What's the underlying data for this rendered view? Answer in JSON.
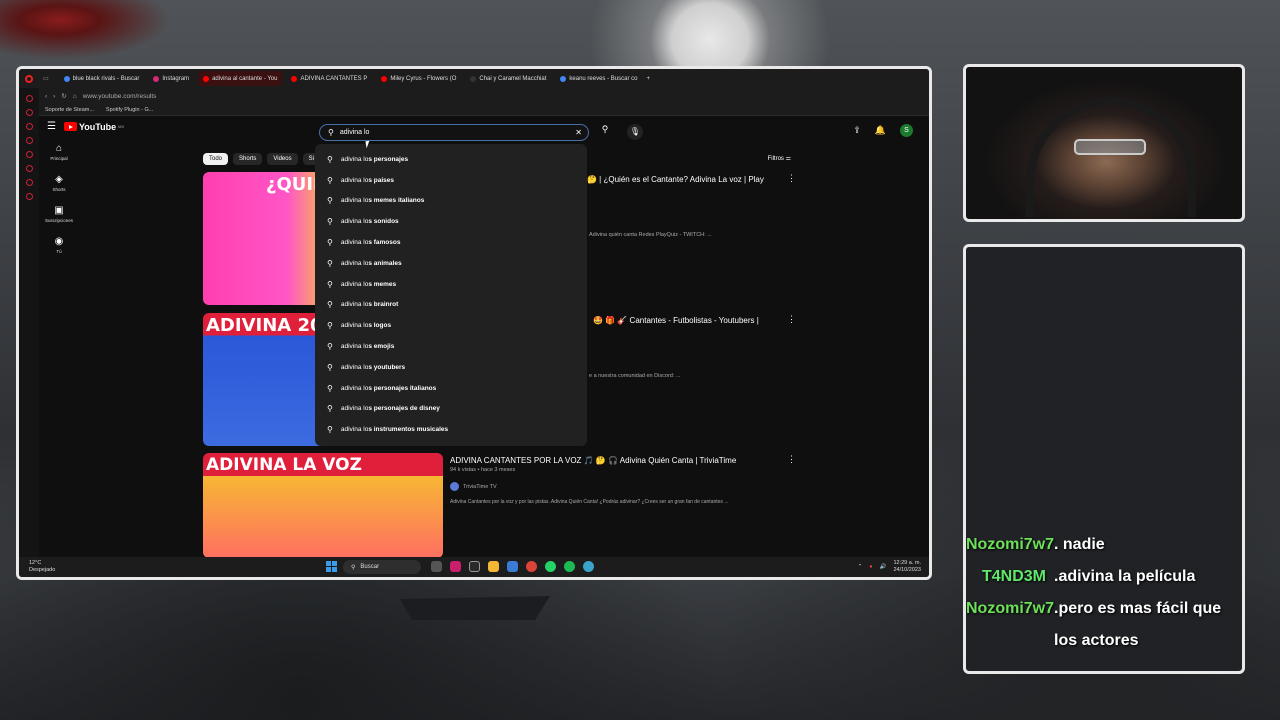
{
  "browser": {
    "tabs": [
      {
        "label": "blue black rivals - Buscar",
        "color": "#4285f4",
        "active": false
      },
      {
        "label": "Instagram",
        "color": "#d62976",
        "active": false
      },
      {
        "label": "adivina al cantante - You",
        "color": "#ff0000",
        "active": true
      },
      {
        "label": "ADIVINA CANTANTES P",
        "color": "#ff0000",
        "active": false
      },
      {
        "label": "Miley Cyrus - Flowers (O",
        "color": "#ff0000",
        "active": false
      },
      {
        "label": "Chai y Caramel Macchiat",
        "color": "#333333",
        "active": false
      },
      {
        "label": "keanu reeves - Buscar co",
        "color": "#4285f4",
        "active": false
      }
    ],
    "url": "www.youtube.com/results",
    "bookmarks": [
      "Soporte de Steam...",
      "Spotify Plugin - G..."
    ]
  },
  "youtube": {
    "logo_text": "YouTube",
    "logo_region": "MX",
    "nav": [
      {
        "icon": "home-icon",
        "glyph": "⌂",
        "label": "Principal"
      },
      {
        "icon": "shorts-icon",
        "glyph": "◈",
        "label": "Shorts"
      },
      {
        "icon": "subscriptions-icon",
        "glyph": "▣",
        "label": "Suscripciones"
      },
      {
        "icon": "you-icon",
        "glyph": "◉",
        "label": "Tú"
      }
    ],
    "search": {
      "value": "adivina lo",
      "clear_glyph": "✕",
      "search_glyph": "⚲",
      "mic_glyph": "🎙"
    },
    "avatar_letter": "S",
    "filters": {
      "label": "Filtros"
    },
    "chips": [
      "Todo",
      "Shorts",
      "Videos",
      "Si"
    ],
    "suggestions": [
      {
        "prefix": "adivina lo",
        "rest": "s personajes"
      },
      {
        "prefix": "adivina lo",
        "rest": "s países"
      },
      {
        "prefix": "adivina lo",
        "rest": "s memes italianos"
      },
      {
        "prefix": "adivina lo",
        "rest": "s sonidos"
      },
      {
        "prefix": "adivina lo",
        "rest": "s famosos"
      },
      {
        "prefix": "adivina lo",
        "rest": "s animales"
      },
      {
        "prefix": "adivina lo",
        "rest": "s memes"
      },
      {
        "prefix": "adivina lo",
        "rest": "s brainrot"
      },
      {
        "prefix": "adivina lo",
        "rest": "s logos"
      },
      {
        "prefix": "adivina lo",
        "rest": "s emojis"
      },
      {
        "prefix": "adivina lo",
        "rest": "s youtubers"
      },
      {
        "prefix": "adivina lo",
        "rest": "s personajes italianos"
      },
      {
        "prefix": "adivina lo",
        "rest": "s personajes de disney"
      },
      {
        "prefix": "adivina lo",
        "rest": "s instrumentos musicales"
      }
    ],
    "videos": [
      {
        "thumb_text": "¿QUIÉ",
        "title_tail": "🤔 | ¿Quién es el Cantante? Adivina La voz | Play",
        "desc_tail": "Adivina quién canta Redes PlayQuiz - TWITCH: ..."
      },
      {
        "thumb_text": "ADIVINA 20",
        "title_tail": "🤩 🎁 🎸 Cantantes - Futbolistas - Youtubers |",
        "desc_tail": "e a nuestra comunidad en Discord: ..."
      },
      {
        "thumb_text": "ADIVINA LA VOZ",
        "title": "ADIVINA CANTANTES POR LA VOZ 🎵 🤔 🎧 Adivina Quién Canta | TriviaTime",
        "meta": "94 k vistas • hace 3 meses",
        "channel": "TriviaTime TV",
        "desc": "Adivina Cantantes por la voz y por las pistas. Adivina Quién Canta! ¿Podrás adivinar? ¿Crees ser un gran fan de cantantes ..."
      }
    ]
  },
  "taskbar": {
    "temp": "12°C",
    "weather": "Despejado",
    "search_label": "Buscar",
    "time": "12:29 a. m.",
    "date": "24/10/2023"
  },
  "chat": [
    {
      "user": "Nozomi7w7",
      "color": "#6ee05a",
      "text": ". nadie"
    },
    {
      "user": "T4ND3M",
      "color": "#5fe86a",
      "text": ".adivina la película"
    },
    {
      "user": "Nozomi7w7",
      "color": "#6ee05a",
      "text": ".pero es mas fácil que los actores"
    }
  ]
}
